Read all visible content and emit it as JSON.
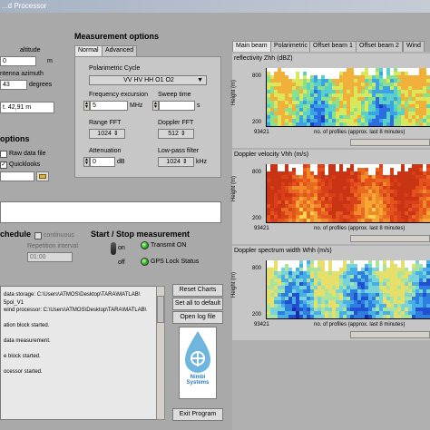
{
  "window": {
    "title": "...d Processor"
  },
  "location": {
    "altitude_label": "altitude",
    "altitude_value": "0",
    "altitude_unit": "m",
    "azimuth_label": "ntenna azimuth",
    "azimuth_value": "43",
    "azimuth_unit": "degrees",
    "coord_value": "t. 42,91 m"
  },
  "options": {
    "header": "options",
    "raw_data_label": "Raw data file",
    "quicklooks_label": "Quicklooks",
    "quicklooks_checked": true
  },
  "schedule": {
    "header": "chedule",
    "continuous_label": "continuous",
    "repetition_label": "Repetition interval",
    "repetition_value": "01:00"
  },
  "measurement": {
    "header": "Measurement options",
    "tabs": [
      "Normal",
      "Advanced"
    ],
    "active_tab": "Normal",
    "polarimetric_label": "Polarimetric Cycle",
    "polarimetric_value": "VV HV HH O1 O2",
    "freq_label": "Frequency excursion",
    "freq_value": "5",
    "freq_unit": "MHz",
    "sweep_label": "Sweep time",
    "sweep_unit": "s",
    "range_fft_label": "Range FFT",
    "range_fft_value": "1024",
    "doppler_fft_label": "Doppler FFT",
    "doppler_fft_value": "512",
    "atten_label": "Attenuation",
    "atten_value": "0",
    "atten_unit": "dB",
    "lowpass_label": "Low-pass filter",
    "lowpass_value": "1024",
    "lowpass_unit": "kHz"
  },
  "startstop": {
    "header": "Start / Stop measurement",
    "on_label": "on",
    "off_label": "off",
    "transmit_label": "Transmit ON",
    "gps_label": "GPS Lock Status"
  },
  "log": {
    "lines": [
      "data storage: C:\\Users\\ATMOS\\Desktop\\TARA\\MATLAB\\",
      "5pol_V1",
      "wind processor: C:\\Users\\ATMOS\\Desktop\\TARA\\MATLAB\\",
      "",
      "ation block started.",
      "",
      "data measurement.",
      "",
      "e block started.",
      "",
      "ocessor started."
    ]
  },
  "buttons": {
    "reset": "Reset Charts",
    "default": "Set all to default",
    "openlog": "Open log file",
    "exit": "Exit Program",
    "logo_text": "Nimbi Systems"
  },
  "charts": {
    "tabs": [
      "Main beam",
      "Polarimetric",
      "Offset beam 1",
      "Offset beam 2",
      "Wind"
    ],
    "active_tab": "Main beam",
    "panels": [
      {
        "title": "reflectivity Zhh (dBZ)",
        "ylabel": "Height (m)",
        "ytick_top": "800",
        "ytick_bottom": "200",
        "xtick": "93421",
        "xcaption": "no. of profiles (approx. last 8 minutes)",
        "palette": "blue-green"
      },
      {
        "title": "Doppler velocity Vhh (m/s)",
        "ylabel": "Height (m)",
        "ytick_top": "800",
        "ytick_bottom": "200",
        "xtick": "93421",
        "xcaption": "no. of profiles (approx. last 8 minutes)",
        "palette": "orange-red"
      },
      {
        "title": "Doppler spectrum width Whh (m/s)",
        "ylabel": "Height (m)",
        "ytick_top": "800",
        "ytick_bottom": "200",
        "xtick": "93421",
        "xcaption": "no. of profiles (approx. last 8 minutes)",
        "palette": "blue-cyan"
      }
    ]
  }
}
